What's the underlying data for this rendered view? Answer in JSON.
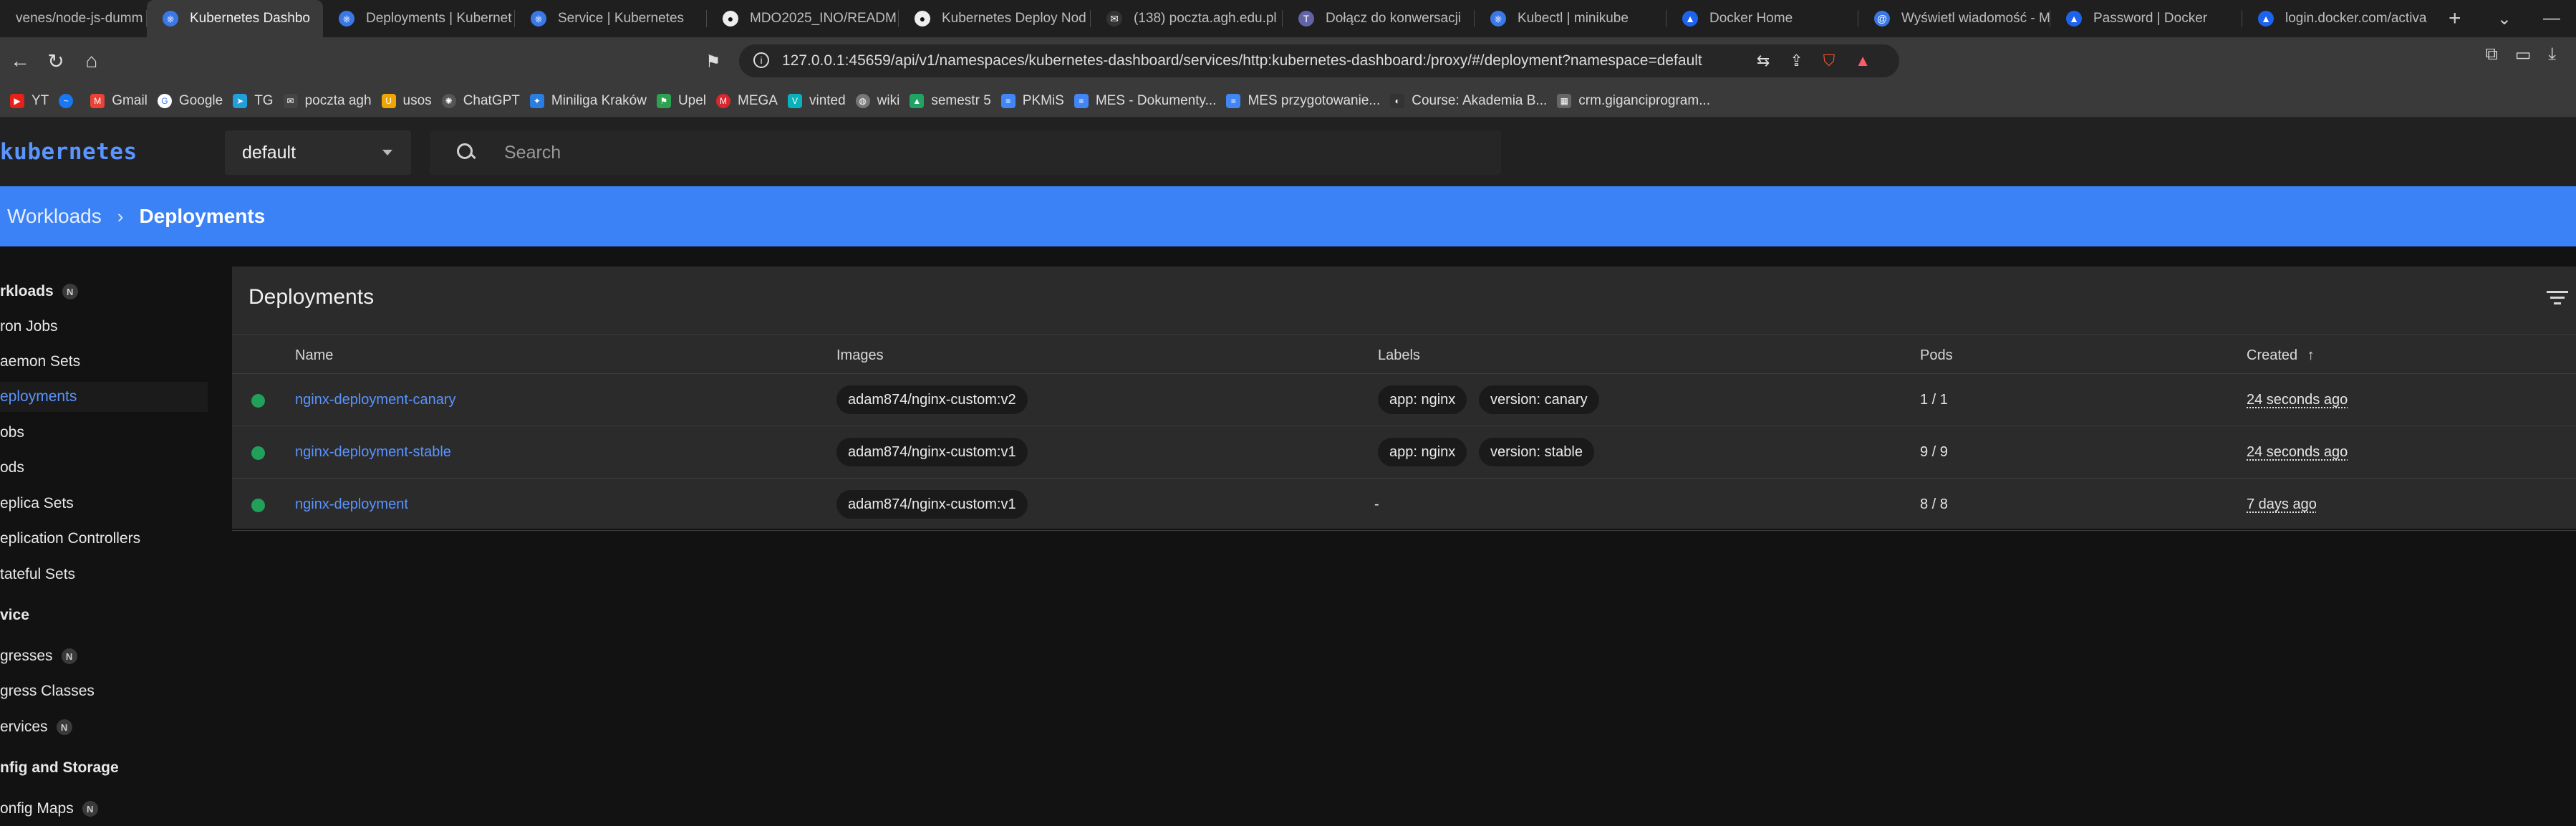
{
  "browser": {
    "tabs": [
      {
        "label": "venes/node-js-dumm",
        "icon": "file-icon"
      },
      {
        "label": "Kubernetes Dashbo",
        "icon": "kubernetes-icon",
        "active": true
      },
      {
        "label": "Deployments | Kubernet",
        "icon": "kubernetes-icon"
      },
      {
        "label": "Service | Kubernetes",
        "icon": "kubernetes-icon"
      },
      {
        "label": "MDO2025_INO/READM",
        "icon": "github-icon"
      },
      {
        "label": "Kubernetes Deploy Nod",
        "icon": "github-icon"
      },
      {
        "label": "(138) poczta.agh.edu.pl",
        "icon": "mail-icon"
      },
      {
        "label": "Dołącz do konwersacji",
        "icon": "teams-icon"
      },
      {
        "label": "Kubectl | minikube",
        "icon": "minikube-icon"
      },
      {
        "label": "Docker Home",
        "icon": "docker-icon"
      },
      {
        "label": "Wyświetl wiadomość - M",
        "icon": "mail-icon"
      },
      {
        "label": "Password | Docker",
        "icon": "docker-icon"
      },
      {
        "label": "login.docker.com/activa",
        "icon": "docker-icon"
      }
    ],
    "url": "127.0.0.1:45659/api/v1/namespaces/kubernetes-dashboard/services/http:kubernetes-dashboard:/proxy/#/deployment?namespace=default",
    "bookmarks": [
      {
        "label": "YT",
        "color": "#e62117"
      },
      {
        "label": "",
        "color": "#1877f2"
      },
      {
        "label": "Gmail",
        "color": "#ea4335"
      },
      {
        "label": "Google",
        "color": "#4285f4"
      },
      {
        "label": "TG",
        "color": "#229ed9"
      },
      {
        "label": "poczta agh",
        "color": "#444444"
      },
      {
        "label": "usos",
        "color": "#f0a500"
      },
      {
        "label": "ChatGPT",
        "color": "#555555"
      },
      {
        "label": "Miniliga Kraków",
        "color": "#2a7de1"
      },
      {
        "label": "Upel",
        "color": "#2ca24f"
      },
      {
        "label": "MEGA",
        "color": "#d9272e"
      },
      {
        "label": "vinted",
        "color": "#09b1ba"
      },
      {
        "label": "wiki",
        "color": "#777777"
      },
      {
        "label": "semestr 5",
        "color": "#1fa463"
      },
      {
        "label": "PKMiS",
        "color": "#4285f4"
      },
      {
        "label": "MES - Dokumenty...",
        "color": "#4285f4"
      },
      {
        "label": "MES przygotowanie...",
        "color": "#4285f4"
      },
      {
        "label": "Course: Akademia B...",
        "color": "#333333"
      },
      {
        "label": "crm.giganciprogram...",
        "color": "#666666"
      }
    ]
  },
  "header": {
    "logo": "kubernetes",
    "namespace": "default",
    "search_placeholder": "Search"
  },
  "breadcrumb": {
    "parent": "Workloads",
    "current": "Deployments"
  },
  "sidebar": {
    "items": [
      {
        "label": "rkloads",
        "header": true,
        "badge": "N"
      },
      {
        "label": "ron Jobs"
      },
      {
        "label": "aemon Sets"
      },
      {
        "label": "eployments",
        "active": true
      },
      {
        "label": "obs"
      },
      {
        "label": "ods"
      },
      {
        "label": "eplica Sets"
      },
      {
        "label": "eplication Controllers"
      },
      {
        "label": "tateful Sets"
      },
      {
        "label": "vice",
        "header": true
      },
      {
        "label": "gresses",
        "badge": "N"
      },
      {
        "label": "gress Classes"
      },
      {
        "label": "ervices",
        "badge": "N"
      },
      {
        "label": "nfig and Storage",
        "header": true
      },
      {
        "label": "onfig Maps",
        "badge": "N"
      }
    ]
  },
  "deployments": {
    "title": "Deployments",
    "columns": {
      "name": "Name",
      "images": "Images",
      "labels": "Labels",
      "pods": "Pods",
      "created": "Created",
      "sort_arrow": "↑"
    },
    "rows": [
      {
        "status": "running",
        "name": "nginx-deployment-canary",
        "image": "adam874/nginx-custom:v2",
        "labels": [
          "app: nginx",
          "version: canary"
        ],
        "pods": "1 / 1",
        "created": "24 seconds ago"
      },
      {
        "status": "running",
        "name": "nginx-deployment-stable",
        "image": "adam874/nginx-custom:v1",
        "labels": [
          "app: nginx",
          "version: stable"
        ],
        "pods": "9 / 9",
        "created": "24 seconds ago"
      },
      {
        "status": "running",
        "name": "nginx-deployment",
        "image": "adam874/nginx-custom:v1",
        "labels_text": "-",
        "pods": "8 / 8",
        "created": "7 days ago"
      }
    ]
  },
  "colors": {
    "accent": "#3b82f6",
    "link": "#5a94ff",
    "status_ok": "#21a05a"
  }
}
